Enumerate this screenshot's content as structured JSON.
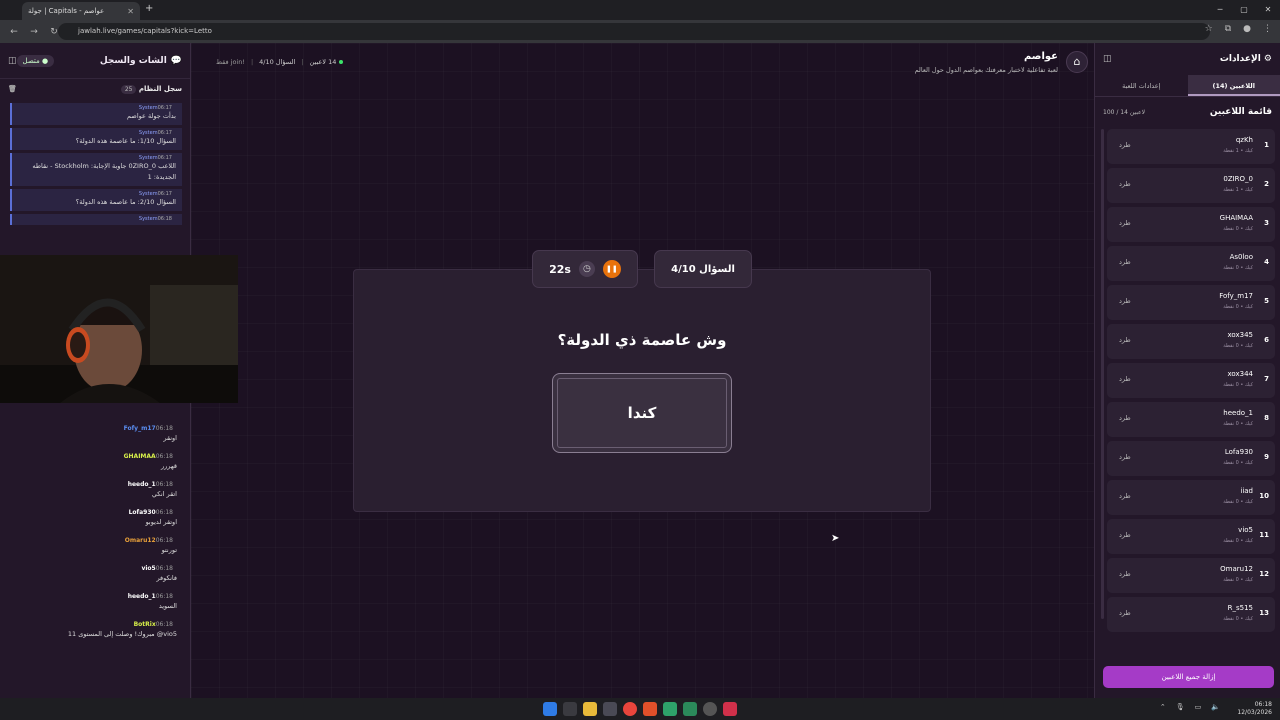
{
  "browser": {
    "tab_title": "جولة | Capitals - عواصم",
    "url": "jawlah.live/games/capitals?kick=Letto"
  },
  "left": {
    "title": "الشات والسجل",
    "online": "متصل",
    "syslog_title": "سجل النظام",
    "syslog_count": "25",
    "syslog": [
      {
        "time": "06:17",
        "sender": "System",
        "text": "بدأت جولة عواصم"
      },
      {
        "time": "06:17",
        "sender": "System",
        "text": "السؤال 1/10: ما عاصمة هذه الدولة؟"
      },
      {
        "time": "06:17",
        "sender": "System",
        "text": "اللاعب 0ZIRO_0 جاوبة الإجابة: Stockholm - نقاطه الجديدة: 1"
      },
      {
        "time": "06:17",
        "sender": "System",
        "text": "السؤال 2/10: ما عاصمة هذه الدولة؟"
      },
      {
        "time": "06:18",
        "sender": "System",
        "text": ""
      }
    ],
    "chat": [
      {
        "time": "06:18",
        "user": "Fofy_m17",
        "color": "#5a8df0",
        "text": "اونقر"
      },
      {
        "time": "06:18",
        "user": "GHAIMAA",
        "color": "#d8f04a",
        "text": "قهررر"
      },
      {
        "time": "06:18",
        "user": "heedo_1",
        "color": "#ffffff",
        "text": "اتقر انكي"
      },
      {
        "time": "06:18",
        "user": "Lofa930",
        "color": "#ffffff",
        "text": "اوتقر لديوبو"
      },
      {
        "time": "06:18",
        "user": "Omaru12",
        "color": "#e8a03a",
        "text": "تورنتو"
      },
      {
        "time": "06:18",
        "user": "vio5",
        "color": "#ffffff",
        "text": "فانكوفر"
      },
      {
        "time": "06:18",
        "user": "heedo_1",
        "color": "#ffffff",
        "text": "السويد"
      },
      {
        "time": "06:18",
        "user": "BotRix",
        "color": "#d8f04a",
        "text": "vio5@ مبروك! وصلت إلى المستوى 11"
      }
    ]
  },
  "center": {
    "game_title": "عواصم",
    "game_sub": "لعبة تفاعلية لاختبار معرفتك بعواصم الدول حول العالم",
    "players_stat": "14 لاعبين",
    "question_stat": "السؤال 4/10",
    "join_hint": "!join فقط",
    "question_label": "السؤال 4/10",
    "timer": "22s",
    "question": "وش عاصمة ذي الدولة؟",
    "answer": "كندا"
  },
  "right": {
    "title": "الإعدادات",
    "tabs": [
      "اللاعبين (14)",
      "إعدادات اللعبة"
    ],
    "list_title": "قائمة اللاعبين",
    "list_count": "100 / 14 لاعبين",
    "kick_label": "طرد",
    "players": [
      {
        "rank": "1",
        "name": "qzKh",
        "info": "كيك • 1 نقطة"
      },
      {
        "rank": "2",
        "name": "0ZIRO_0",
        "info": "كيك • 1 نقطة"
      },
      {
        "rank": "3",
        "name": "GHAIMAA",
        "info": "كيك • 0 نقطة"
      },
      {
        "rank": "4",
        "name": "As0loo",
        "info": "كيك • 0 نقطة"
      },
      {
        "rank": "5",
        "name": "Fofy_m17",
        "info": "كيك • 0 نقطة"
      },
      {
        "rank": "6",
        "name": "xox345",
        "info": "كيك • 0 نقطة"
      },
      {
        "rank": "7",
        "name": "xox344",
        "info": "كيك • 0 نقطة"
      },
      {
        "rank": "8",
        "name": "heedo_1",
        "info": "كيك • 0 نقطة"
      },
      {
        "rank": "9",
        "name": "Lofa930",
        "info": "كيك • 0 نقطة"
      },
      {
        "rank": "10",
        "name": "iiad",
        "info": "كيك • 0 نقطة"
      },
      {
        "rank": "11",
        "name": "vio5",
        "info": "كيك • 0 نقطة"
      },
      {
        "rank": "12",
        "name": "Omaru12",
        "info": "كيك • 0 نقطة"
      },
      {
        "rank": "13",
        "name": "R_s515",
        "info": "كيك • 0 نقطة"
      }
    ],
    "remove_all": "إزالة جميع اللاعبين"
  },
  "taskbar": {
    "time": "06:18",
    "date": "12/03/2026"
  }
}
